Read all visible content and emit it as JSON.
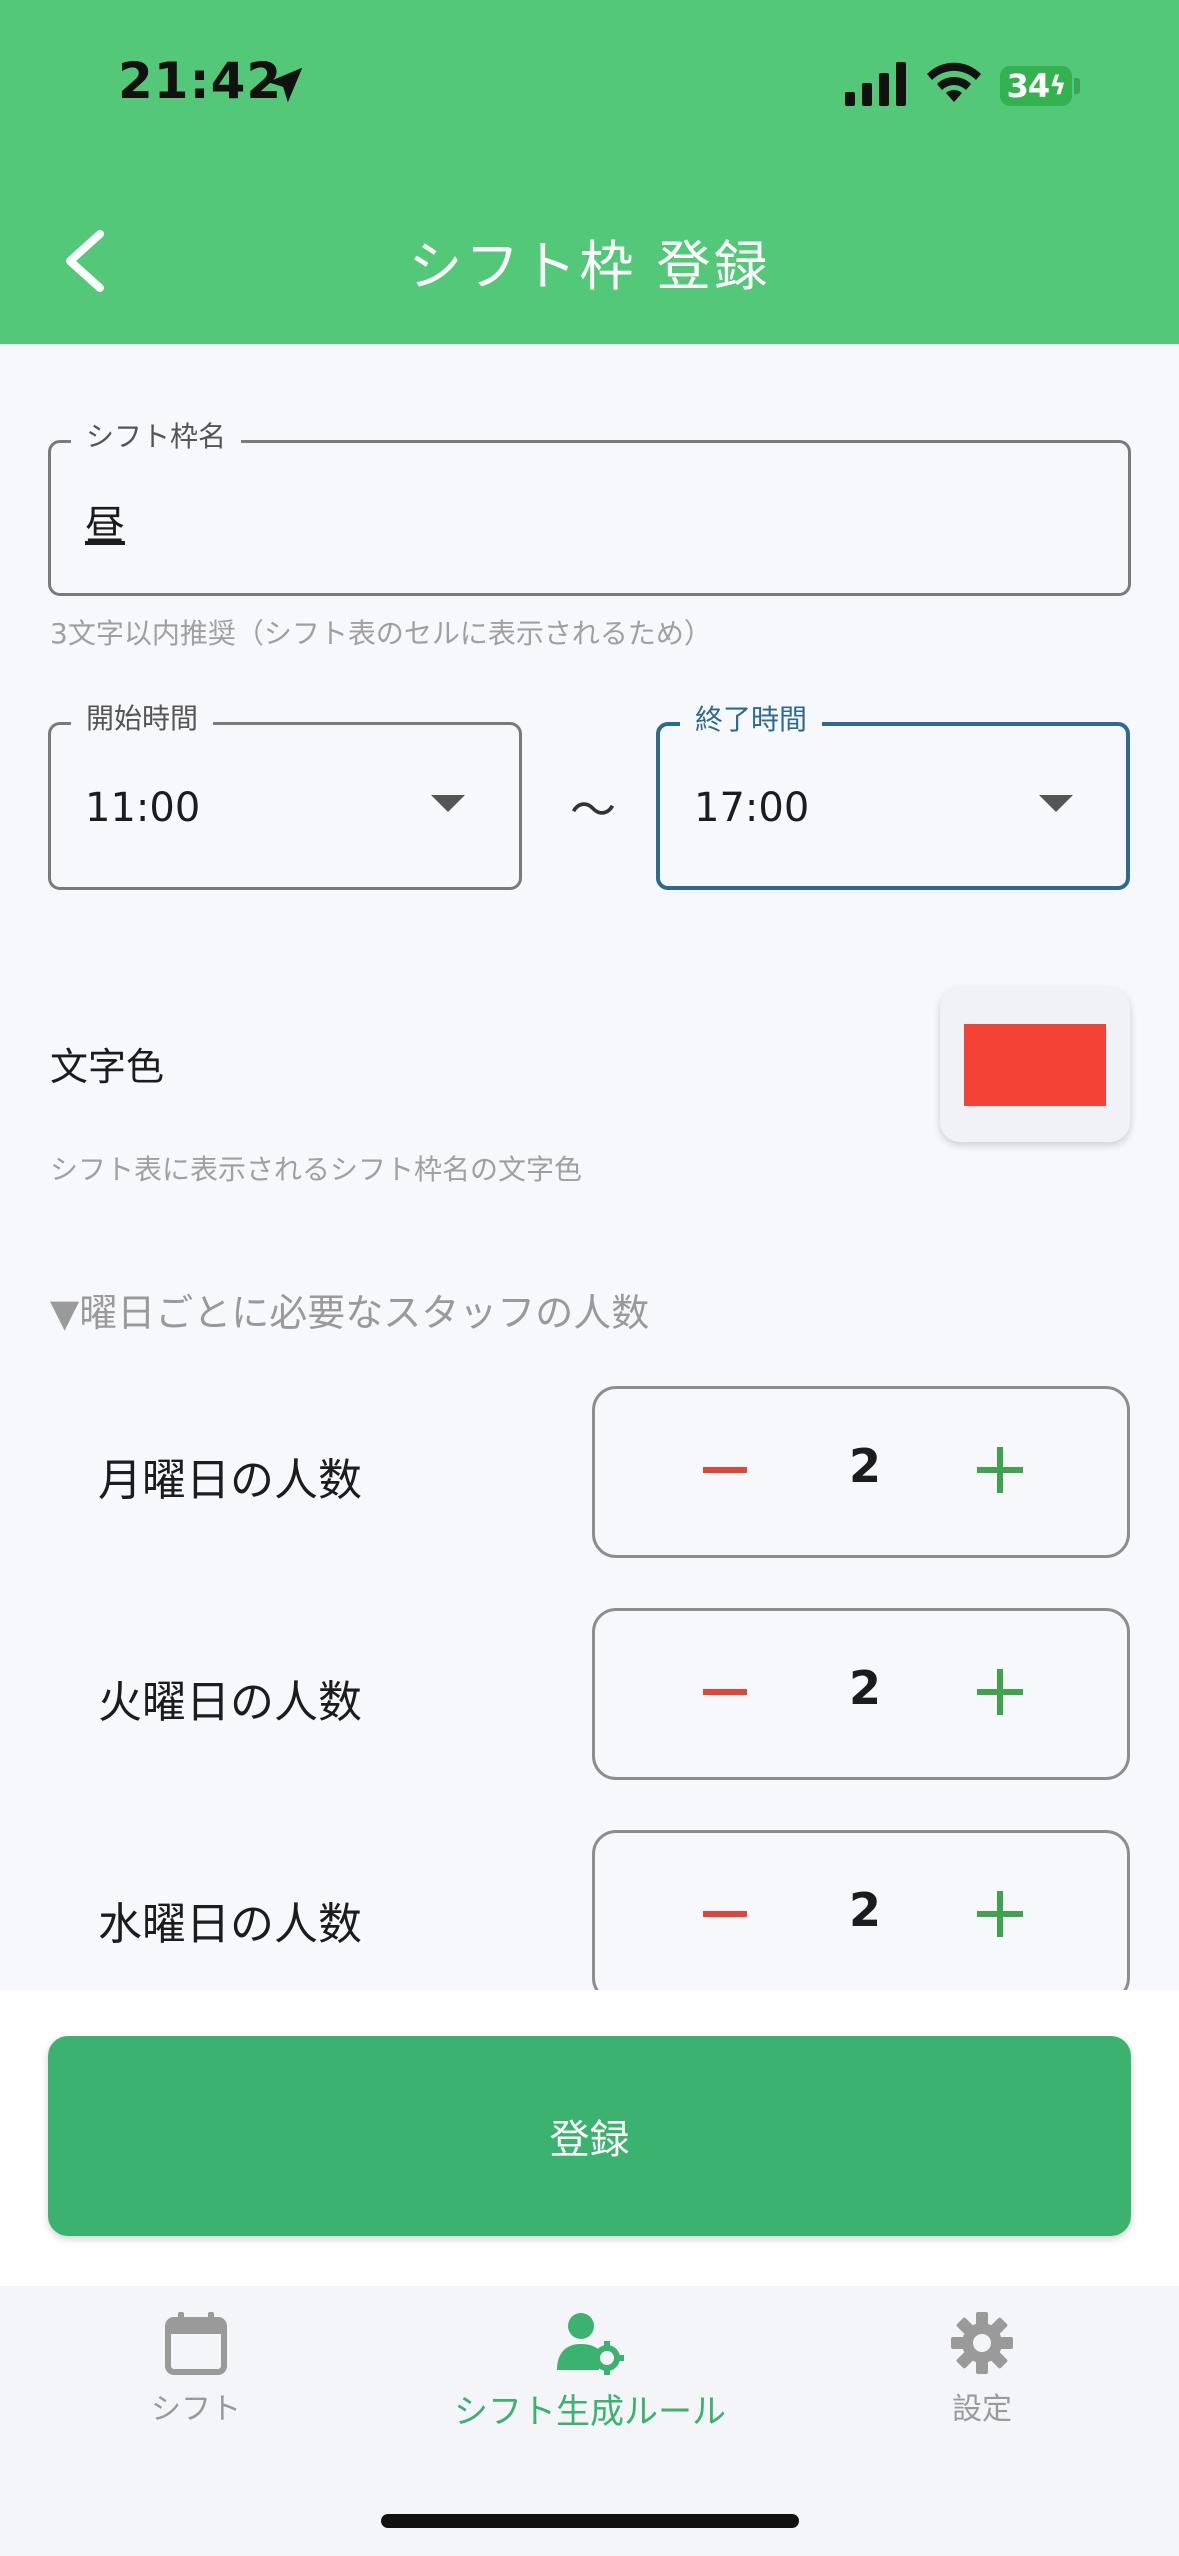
{
  "status_bar": {
    "time": "21:42",
    "battery": "34"
  },
  "header": {
    "title": "シフト枠 登録"
  },
  "form": {
    "shift_name": {
      "label": "シフト枠名",
      "value": "昼",
      "helper": "3文字以内推奨（シフト表のセルに表示されるため）"
    },
    "start_time": {
      "label": "開始時間",
      "value": "11:00"
    },
    "separator": "〜",
    "end_time": {
      "label": "終了時間",
      "value": "17:00"
    },
    "text_color": {
      "label": "文字色",
      "helper": "シフト表に表示されるシフト枠名の文字色",
      "color": "#F44336"
    },
    "section_title": "▼曜日ごとに必要なスタッフの人数",
    "staff_counts": [
      {
        "label": "月曜日の人数",
        "value": "2"
      },
      {
        "label": "火曜日の人数",
        "value": "2"
      },
      {
        "label": "水曜日の人数",
        "value": "2"
      }
    ],
    "submit_label": "登録"
  },
  "tabs": [
    {
      "label": "シフト",
      "icon": "calendar-icon",
      "active": false
    },
    {
      "label": "シフト生成ルール",
      "icon": "person-gear-icon",
      "active": true
    },
    {
      "label": "設定",
      "icon": "gear-icon",
      "active": false
    }
  ],
  "colors": {
    "header": "#52C878",
    "primary": "#3BB26E",
    "focus": "#2C6A8F",
    "minus": "#E0453A",
    "plus": "#3FA34D"
  }
}
